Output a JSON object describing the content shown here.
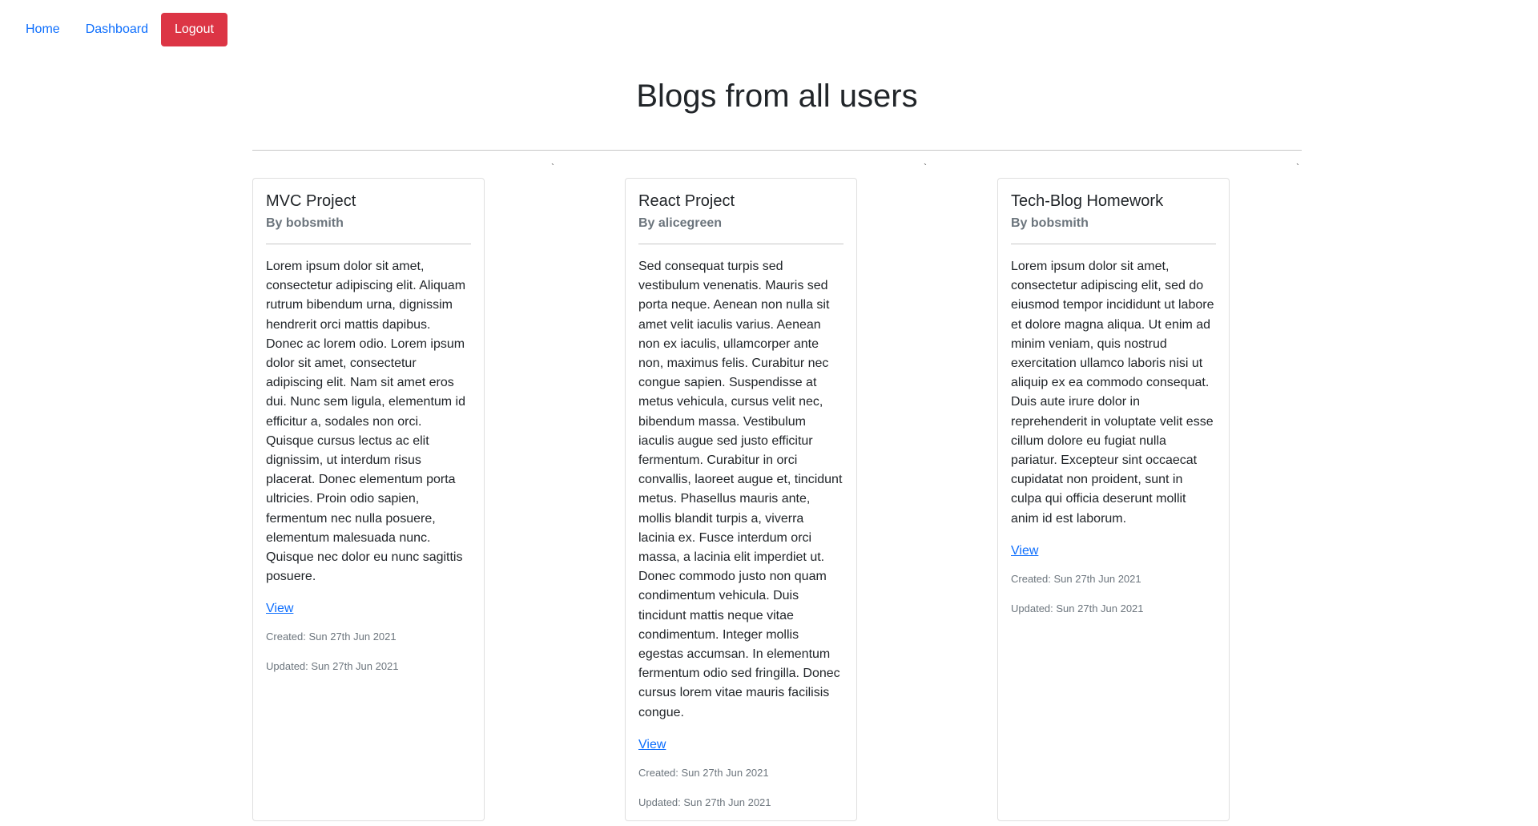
{
  "nav": {
    "home_label": "Home",
    "dashboard_label": "Dashboard",
    "logout_label": "Logout"
  },
  "page": {
    "heading": "Blogs from all users",
    "tick_mark": "`"
  },
  "posts": [
    {
      "title": "MVC Project",
      "author": "By bobsmith",
      "body": "Lorem ipsum dolor sit amet, consectetur adipiscing elit. Aliquam rutrum bibendum urna, dignissim hendrerit orci mattis dapibus. Donec ac lorem odio. Lorem ipsum dolor sit amet, consectetur adipiscing elit. Nam sit amet eros dui. Nunc sem ligula, elementum id efficitur a, sodales non orci. Quisque cursus lectus ac elit dignissim, ut interdum risus placerat. Donec elementum porta ultricies. Proin odio sapien, fermentum nec nulla posuere, elementum malesuada nunc. Quisque nec dolor eu nunc sagittis posuere.",
      "link_label": "View",
      "created": "Created: Sun 27th Jun 2021",
      "updated": "Updated: Sun 27th Jun 2021"
    },
    {
      "title": "React Project",
      "author": "By alicegreen",
      "body": "Sed consequat turpis sed vestibulum venenatis. Mauris sed porta neque. Aenean non nulla sit amet velit iaculis varius. Aenean non ex iaculis, ullamcorper ante non, maximus felis. Curabitur nec congue sapien. Suspendisse at metus vehicula, cursus velit nec, bibendum massa. Vestibulum iaculis augue sed justo efficitur fermentum. Curabitur in orci convallis, laoreet augue et, tincidunt metus. Phasellus mauris ante, mollis blandit turpis a, viverra lacinia ex. Fusce interdum orci massa, a lacinia elit imperdiet ut. Donec commodo justo non quam condimentum vehicula. Duis tincidunt mattis neque vitae condimentum. Integer mollis egestas accumsan. In elementum fermentum odio sed fringilla. Donec cursus lorem vitae mauris facilisis congue.",
      "link_label": "View",
      "created": "Created: Sun 27th Jun 2021",
      "updated": "Updated: Sun 27th Jun 2021"
    },
    {
      "title": "Tech-Blog Homework",
      "author": "By bobsmith",
      "body": "Lorem ipsum dolor sit amet, consectetur adipiscing elit, sed do eiusmod tempor incididunt ut labore et dolore magna aliqua. Ut enim ad minim veniam, quis nostrud exercitation ullamco laboris nisi ut aliquip ex ea commodo consequat. Duis aute irure dolor in reprehenderit in voluptate velit esse cillum dolore eu fugiat nulla pariatur. Excepteur sint occaecat cupidatat non proident, sunt in culpa qui officia deserunt mollit anim id est laborum.",
      "link_label": "View",
      "created": "Created: Sun 27th Jun 2021",
      "updated": "Updated: Sun 27th Jun 2021"
    }
  ],
  "colors": {
    "link": "#0d6efd",
    "danger": "#dc3545",
    "muted": "#6c757d",
    "text": "#212529"
  }
}
